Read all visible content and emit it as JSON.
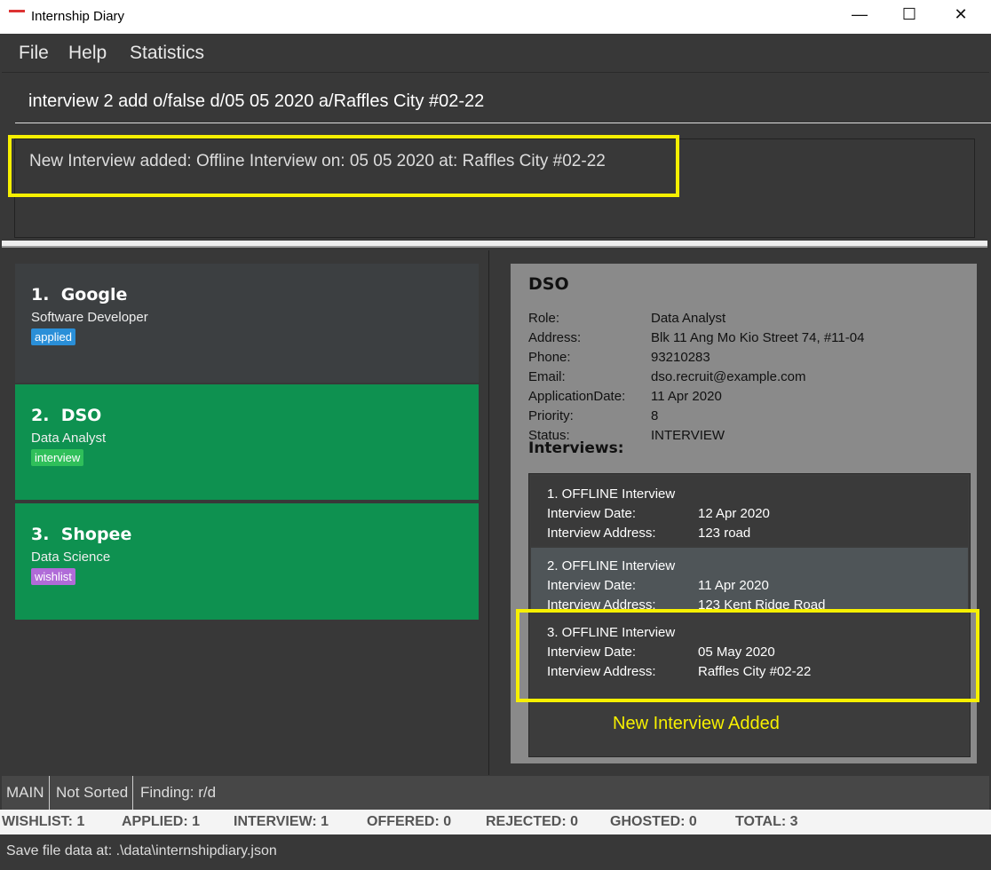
{
  "window": {
    "title": "Internship Diary",
    "icon": "app-logo-icon"
  },
  "menu": [
    "File",
    "Help",
    "Statistics"
  ],
  "command": {
    "value": "interview 2 add o/false d/05 05 2020 a/Raffles City #02-22"
  },
  "result": "New Interview added: Offline Interview on: 05 05 2020 at: Raffles City #02-22",
  "list": [
    {
      "index": "1.",
      "company": "Google",
      "role": "Software Developer",
      "tag": "applied",
      "tag_color": "#2a8fd8",
      "bg": "#3c3f41"
    },
    {
      "index": "2.",
      "company": "DSO",
      "role": "Data Analyst",
      "tag": "interview",
      "tag_color": "#2fbf5a",
      "bg": "#0e9150"
    },
    {
      "index": "3.",
      "company": "Shopee",
      "role": "Data Science",
      "tag": "wishlist",
      "tag_color": "#b06bd8",
      "bg": "#0e9150"
    }
  ],
  "detail": {
    "company": "DSO",
    "fields": [
      {
        "label": "Role:",
        "value": "Data Analyst"
      },
      {
        "label": "Address:",
        "value": "Blk 11 Ang Mo Kio Street 74, #11-04"
      },
      {
        "label": "Phone:",
        "value": "93210283"
      },
      {
        "label": "Email:",
        "value": "dso.recruit@example.com"
      },
      {
        "label": "ApplicationDate:",
        "value": "11 Apr 2020"
      },
      {
        "label": "Priority:",
        "value": "8"
      },
      {
        "label": "Status:",
        "value": "INTERVIEW"
      }
    ],
    "interviews_heading": "Interviews:",
    "date_label": "Interview Date:",
    "address_label": "Interview Address:",
    "interviews": [
      {
        "title": "1. OFFLINE Interview",
        "date": "12 Apr 2020",
        "address": "123 road"
      },
      {
        "title": "2. OFFLINE Interview",
        "date": "11 Apr 2020",
        "address": "123 Kent Ridge Road"
      },
      {
        "title": "3. OFFLINE Interview",
        "date": "05 May 2020",
        "address": "Raffles City #02-22"
      }
    ]
  },
  "annotation": "New Interview Added",
  "status": [
    "MAIN",
    "Not Sorted",
    "Finding: r/d"
  ],
  "stats": [
    "WISHLIST: 1",
    "APPLIED: 1",
    "INTERVIEW: 1",
    "OFFERED: 0",
    "REJECTED: 0",
    "GHOSTED: 0",
    "TOTAL: 3"
  ],
  "footer": "Save file data at: .\\data\\internshipdiary.json",
  "colors": {
    "highlight": "#f7f000",
    "selected": "#0e9150"
  }
}
